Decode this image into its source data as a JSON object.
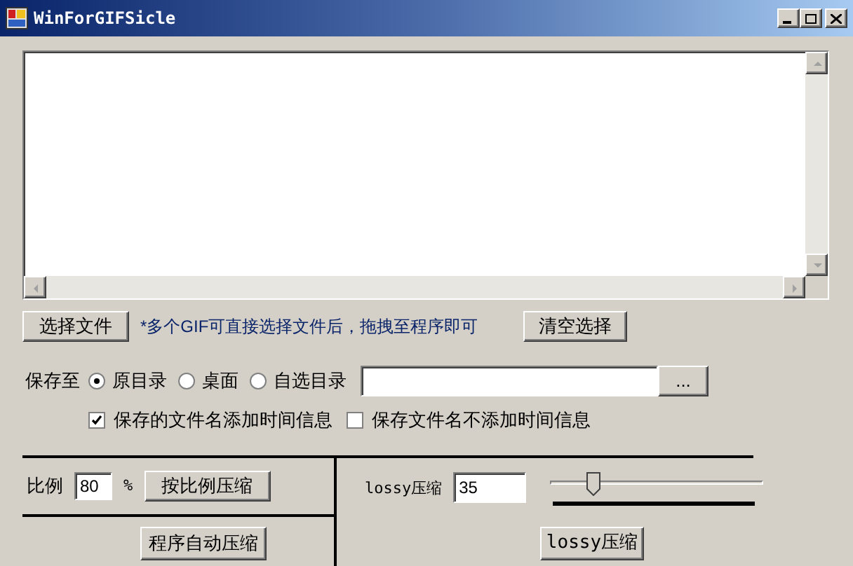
{
  "window": {
    "title": "WinForGIFSicle"
  },
  "select_button": "选择文件",
  "hint": "*多个GIF可直接选择文件后，拖拽至程序即可",
  "clear_button": "清空选择",
  "save_to": {
    "label": "保存至",
    "options": [
      {
        "label": "原目录",
        "selected": true
      },
      {
        "label": "桌面",
        "selected": false
      },
      {
        "label": "自选目录",
        "selected": false
      }
    ],
    "browse_button": "..."
  },
  "name_options": [
    {
      "label": "保存的文件名添加时间信息",
      "checked": true
    },
    {
      "label": "保存文件名不添加时间信息",
      "checked": false
    }
  ],
  "ratio": {
    "label": "比例",
    "value": "80",
    "unit": "%",
    "button": "按比例压缩"
  },
  "auto_button": "程序自动压缩",
  "lossy": {
    "label": "lossy压缩",
    "value": "35",
    "level": 0.18,
    "button": "lossy压缩"
  }
}
